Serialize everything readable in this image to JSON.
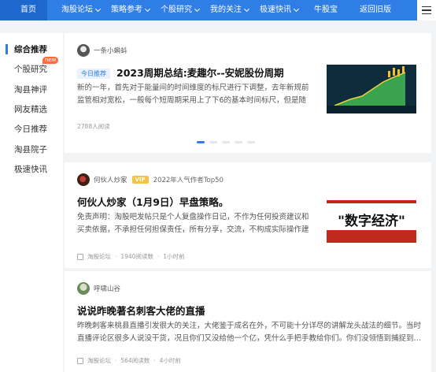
{
  "nav": {
    "items": [
      {
        "label": "首页",
        "dropdown": false
      },
      {
        "label": "淘股论坛",
        "dropdown": true
      },
      {
        "label": "策略参考",
        "dropdown": true
      },
      {
        "label": "个股研究",
        "dropdown": true
      },
      {
        "label": "我的关注",
        "dropdown": true
      },
      {
        "label": "极速快讯",
        "dropdown": true
      },
      {
        "label": "牛股宝",
        "dropdown": false
      },
      {
        "label": "返回旧版",
        "dropdown": false
      }
    ],
    "active": "首页"
  },
  "sidebar": {
    "items": [
      {
        "label": "综合推荐"
      },
      {
        "label": "个股研究",
        "badge": "new"
      },
      {
        "label": "淘县神评"
      },
      {
        "label": "网友精选"
      },
      {
        "label": "今日推荐"
      },
      {
        "label": "淘县院子"
      },
      {
        "label": "极速快讯"
      }
    ]
  },
  "posts": [
    {
      "author": "一条小蝌蚪",
      "tag": "今日推荐",
      "title": "2023周期总结:麦趣尔--安妮股份周期",
      "body": "新的一年，首先对于能量间的时间维度的标尺进行下调整，去年新规前监管相对宽松，一般每个短周期采用上了下6的基本时间标尺，但是随着…",
      "views": "2788人阅读"
    },
    {
      "author": "何伙人炒家",
      "vip": "VIP",
      "author_tag": "2022年人气作者Top50",
      "title": "何伙人炒家（1月9日）早盘策略。",
      "body": "免责声明：淘股吧发帖只是个人复盘操作日记，不作为任何投资建议和买卖依据，不承担任何担保责任，所有分享，交流，不构成实际操作建议…",
      "source": "淘股论坛",
      "views": "1940阅读数",
      "time": "1小时前",
      "thumb_text": "\"数字经济\""
    },
    {
      "author": "呼啸山谷",
      "title": "说说昨晚著名刺客大佬的直播",
      "body": "昨晚刺客来桃县直播引发很大的关注，大佬鉴于成名在外，不可能十分详尽的讲解龙头战法的细节。当时直播评论区很多人说没干货，况且你们又没给他一个亿，凭什么手把手教给你们。你们没领悟到捕捉到…",
      "source": "淘股论坛",
      "views": "564阅读数",
      "time": "4小时前"
    }
  ],
  "carousel": {
    "count": 5,
    "active": 0
  },
  "colors": {
    "accent": "#2f7ee6",
    "badge": "#ff6a3d",
    "vip": "#f5c242"
  }
}
